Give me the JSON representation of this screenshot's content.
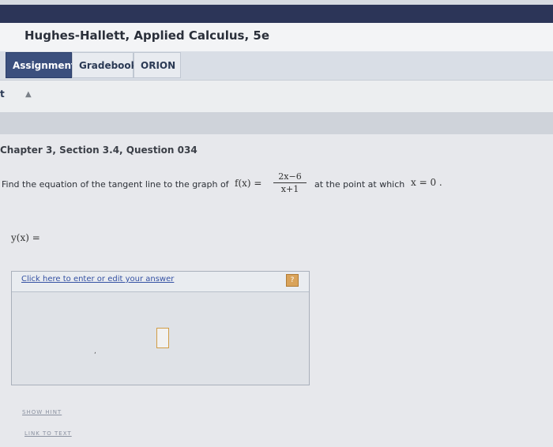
{
  "header": {
    "course_title": "Hughes-Hallett, Applied Calculus, 5e"
  },
  "nav": {
    "tabs": [
      "Assignment",
      "Gradebook",
      "ORION"
    ]
  },
  "page": {
    "left_cut_text": "t"
  },
  "question": {
    "title": "Chapter 3, Section 3.4, Question 034",
    "prompt_before": "Find the equation of the tangent line to the graph of",
    "prompt_after": "at the point at which",
    "function_lhs": "f(x) =",
    "numerator": "2x−6",
    "denominator": "x+1",
    "point": "x = 0 ."
  },
  "answer": {
    "label": "y(x) =",
    "editor_link": "Click here to enter or edit your answer"
  },
  "footer": {
    "show_hint": "SHOW HINT",
    "link_to_text": "LINK TO TEXT"
  }
}
